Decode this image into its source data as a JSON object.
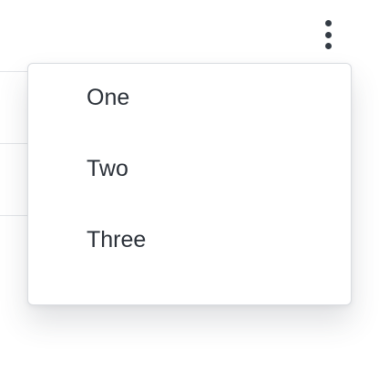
{
  "toolbar": {
    "kebab_icon": "vertical-ellipsis-icon"
  },
  "menu": {
    "items": [
      {
        "label": "One"
      },
      {
        "label": "Two"
      },
      {
        "label": "Three"
      }
    ]
  },
  "colors": {
    "icon": "#333b44",
    "text": "#2a3038",
    "menu_border": "#d9dce0",
    "divider": "#e3e5e8",
    "background": "#ffffff"
  }
}
